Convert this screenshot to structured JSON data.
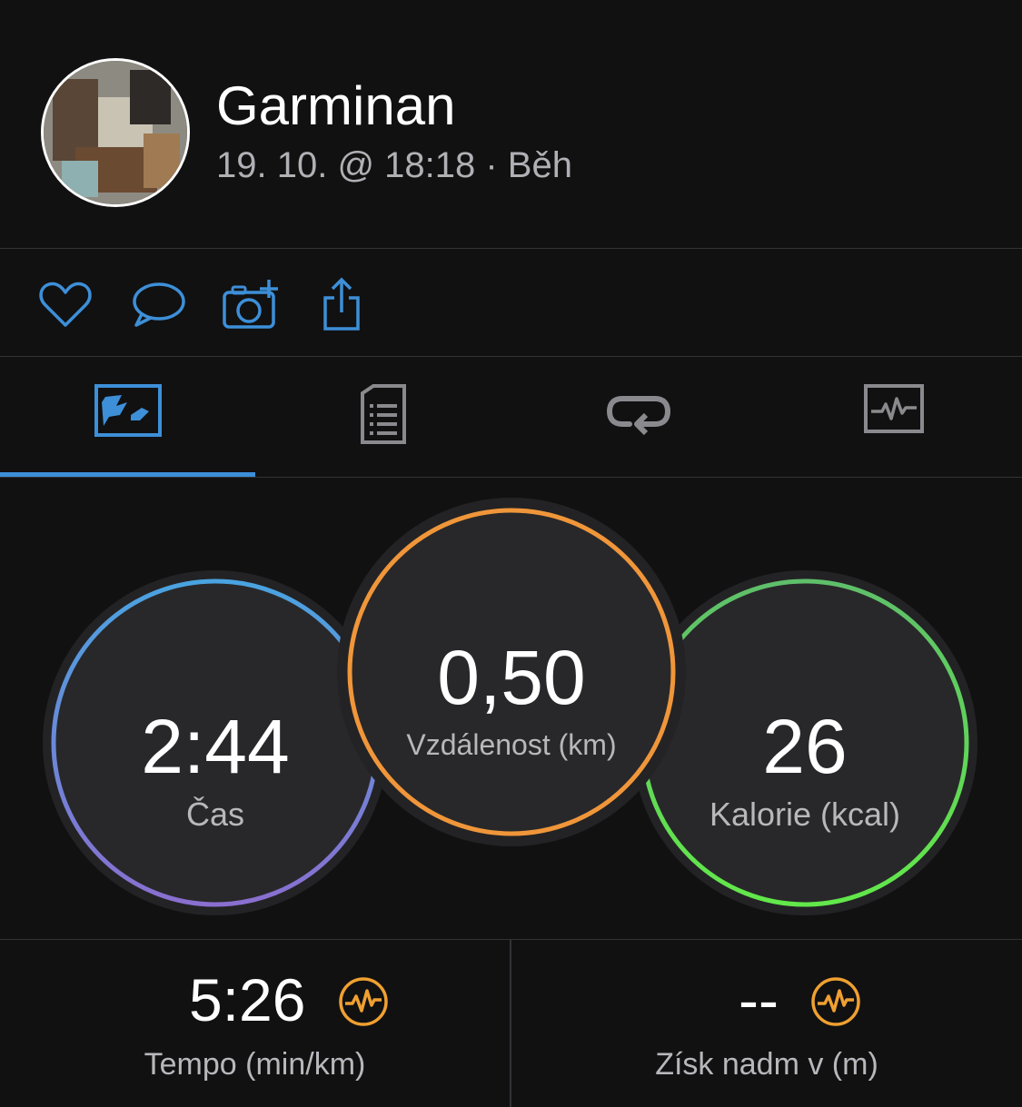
{
  "header": {
    "user_name": "Garminan",
    "meta": "19. 10. @ 18:18 · Běh"
  },
  "actions": [
    {
      "icon": "heart-icon"
    },
    {
      "icon": "comment-icon"
    },
    {
      "icon": "add-photo-icon"
    },
    {
      "icon": "share-icon"
    }
  ],
  "tabs": [
    {
      "icon": "map-icon",
      "active": true
    },
    {
      "icon": "details-icon",
      "active": false
    },
    {
      "icon": "laps-icon",
      "active": false
    },
    {
      "icon": "graph-icon",
      "active": false
    }
  ],
  "metrics": {
    "time": {
      "value": "2:44",
      "label": "Čas"
    },
    "distance": {
      "value": "0,50",
      "label": "Vzdálenost (km)"
    },
    "calories": {
      "value": "26",
      "label": "Kalorie (kcal)"
    }
  },
  "stats": {
    "tempo": {
      "value": "5:26",
      "label": "Tempo (min/km)"
    },
    "elevation": {
      "value": "--",
      "label": "Získ nadm v (m)"
    }
  },
  "colors": {
    "accent": "#3d8fd8",
    "time_ring": [
      "#4aa3e0",
      "#8a6fd0"
    ],
    "distance_ring": "#f0963a",
    "calories_ring": [
      "#5fbf6a",
      "#62e84a"
    ],
    "insight_icon": "#f0a030"
  }
}
